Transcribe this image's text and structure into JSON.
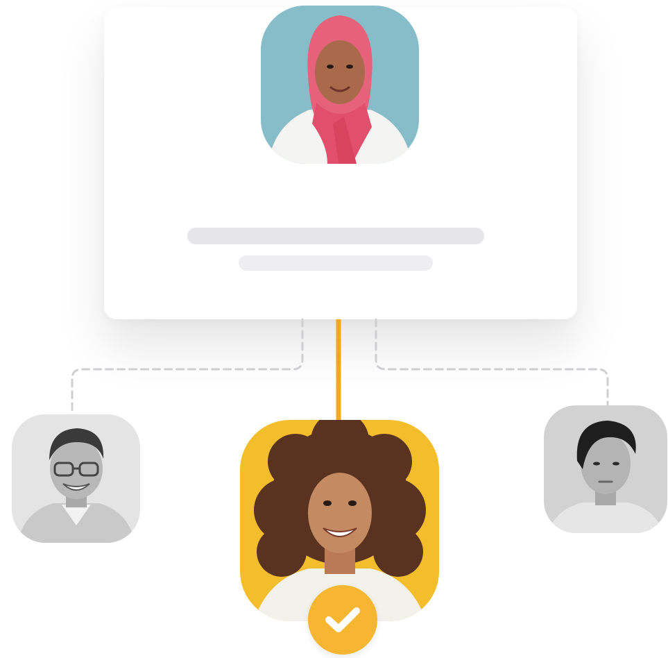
{
  "nodes": {
    "top": {
      "icon": "woman-pink-hijab-portrait",
      "background": "#8cc1cd"
    },
    "left": {
      "icon": "man-glasses-grayscale-portrait",
      "background": "#e4e4e4"
    },
    "center": {
      "icon": "woman-curly-hair-portrait",
      "background": "#f4bd2c",
      "selected": true
    },
    "right": {
      "icon": "young-man-grayscale-portrait",
      "background": "#d2d2d2"
    }
  },
  "connectors": {
    "active_color": "#f2a91f",
    "inactive_color": "#cfcfd2",
    "inactive_style": "dashed"
  },
  "badge": {
    "icon": "checkmark-icon",
    "color": "#f6b632"
  },
  "colors": {
    "card_bg": "#ffffff",
    "placeholder_line_1": "#e6e6e8",
    "placeholder_line_2": "#eeeef0"
  }
}
